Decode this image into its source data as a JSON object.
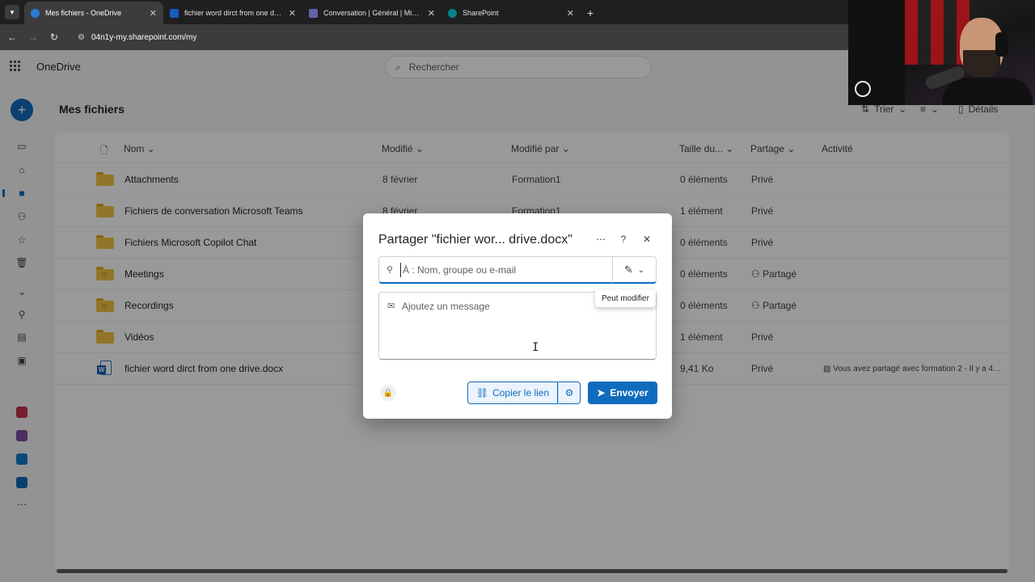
{
  "browser": {
    "tabs": [
      {
        "title": "Mes fichiers - OneDrive",
        "color": "#2b7cd3",
        "active": true
      },
      {
        "title": "fichier word dirct from one drive.docx",
        "color": "#185abd",
        "active": false
      },
      {
        "title": "Conversation | Général | Microsoft Teams",
        "color": "#6264a7",
        "active": false
      },
      {
        "title": "SharePoint",
        "color": "#038387",
        "active": false
      }
    ],
    "url": "04n1y-my.sharepoint.com/my"
  },
  "app": {
    "name": "OneDrive",
    "search_placeholder": "Rechercher",
    "page_title": "Mes fichiers",
    "commands": {
      "sort": "Trier",
      "details": "Détails"
    },
    "columns": {
      "name": "Nom",
      "modified": "Modifié",
      "modified_by": "Modifié par",
      "size": "Taille du...",
      "sharing": "Partage",
      "activity": "Activité"
    },
    "files": [
      {
        "name": "Attachments",
        "modified": "8 février",
        "modified_by": "Formation1",
        "size": "0 éléments",
        "sharing": "Privé",
        "activity": ""
      },
      {
        "name": "Fichiers de conversation Microsoft Teams",
        "modified": "8 février",
        "modified_by": "Formation1",
        "size": "1 élément",
        "sharing": "Privé",
        "activity": ""
      },
      {
        "name": "Fichiers Microsoft Copilot Chat",
        "modified": "",
        "modified_by": "",
        "size": "0 éléments",
        "sharing": "Privé",
        "activity": ""
      },
      {
        "name": "Meetings",
        "modified": "",
        "modified_by": "",
        "size": "0 éléments",
        "sharing": "Partagé",
        "activity": ""
      },
      {
        "name": "Recordings",
        "modified": "",
        "modified_by": "",
        "size": "0 éléments",
        "sharing": "Partagé",
        "activity": ""
      },
      {
        "name": "Vidéos",
        "modified": "",
        "modified_by": "",
        "size": "1 élément",
        "sharing": "Privé",
        "activity": ""
      },
      {
        "name": "fichier word dirct from one drive.docx",
        "modified": "",
        "modified_by": "",
        "size": "9,41 Ko",
        "sharing": "Privé",
        "activity": "Vous avez partagé avec formation 2 - Il y a 4 m..."
      }
    ]
  },
  "dialog": {
    "title": "Partager \"fichier wor... drive.docx\"",
    "to_placeholder": "À : Nom, groupe ou e-mail",
    "permission_tooltip": "Peut modifier",
    "message_placeholder": "Ajoutez un message",
    "copy_link": "Copier le lien",
    "send": "Envoyer"
  },
  "colors": {
    "accent": "#0f6cbd",
    "folder": "#f5c343"
  }
}
